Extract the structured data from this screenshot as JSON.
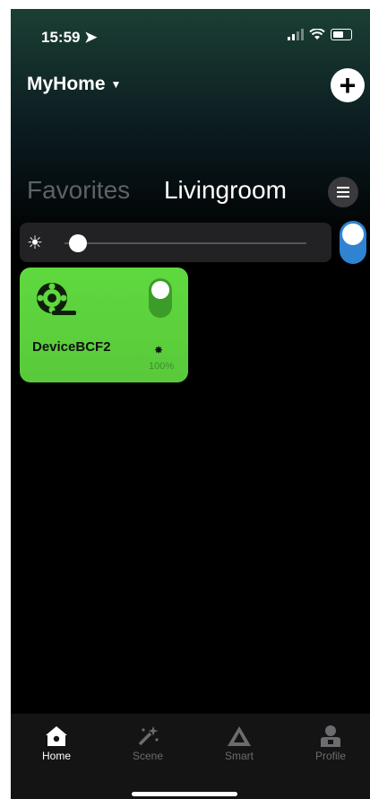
{
  "status": {
    "time": "15:59"
  },
  "header": {
    "home_name": "MyHome"
  },
  "rooms": {
    "favorites": "Favorites",
    "current": "Livingroom"
  },
  "room_brightness": {
    "value_fraction": 0.02,
    "room_switch_on": true
  },
  "device": {
    "name": "DeviceBCF2",
    "brightness": "100%",
    "on": true,
    "icon": "film-reel-icon",
    "card_color": "#5fd93f"
  },
  "tabbar": {
    "items": [
      {
        "label": "Home",
        "icon": "house-icon",
        "active": true
      },
      {
        "label": "Scene",
        "icon": "magic-wand-icon",
        "active": false
      },
      {
        "label": "Smart",
        "icon": "triangle-logo-icon",
        "active": false
      },
      {
        "label": "Profile",
        "icon": "person-icon",
        "active": false
      }
    ]
  }
}
